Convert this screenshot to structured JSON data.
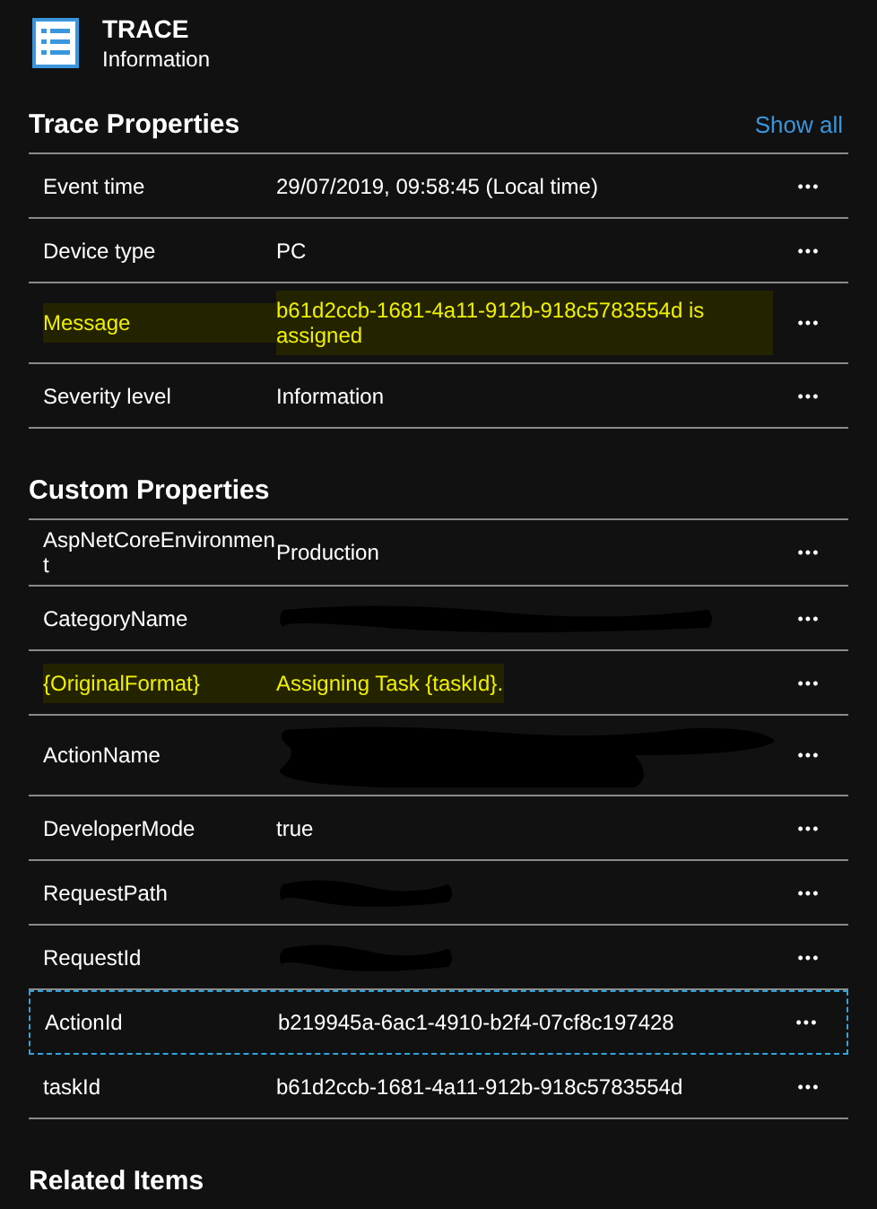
{
  "header": {
    "title": "TRACE",
    "subtitle": "Information"
  },
  "sections": [
    {
      "title": "Trace Properties",
      "link": "Show all",
      "rows": [
        {
          "kind": "text",
          "label": "Event time",
          "value": "29/07/2019, 09:58:45 (Local time)",
          "highlighted": false,
          "focused": false,
          "menu": "•••"
        },
        {
          "kind": "text",
          "label": "Device type",
          "value": "PC",
          "highlighted": false,
          "focused": false,
          "menu": "•••"
        },
        {
          "kind": "text",
          "label": "Message",
          "value": "b61d2ccb-1681-4a11-912b-918c5783554d is assigned",
          "highlighted": true,
          "focused": false,
          "menu": "•••"
        },
        {
          "kind": "text",
          "label": "Severity level",
          "value": "Information",
          "highlighted": false,
          "focused": false,
          "menu": "•••"
        }
      ]
    },
    {
      "title": "Custom Properties",
      "rows": [
        {
          "kind": "text",
          "label": "AspNetCoreEnvironment",
          "value": "Production",
          "highlighted": false,
          "focused": false,
          "menu": "•••"
        },
        {
          "kind": "redacted",
          "label": "CategoryName",
          "highlighted": false,
          "focused": false,
          "menu": "•••"
        },
        {
          "kind": "text",
          "label": "{OriginalFormat}",
          "value": "Assigning Task {taskId}.",
          "highlighted": true,
          "focused": false,
          "menu": "•••"
        },
        {
          "kind": "redacted_multiline",
          "label": "ActionName",
          "highlighted": false,
          "focused": false,
          "menu": "•••"
        },
        {
          "kind": "text",
          "label": "DeveloperMode",
          "value": "true",
          "highlighted": false,
          "focused": false,
          "menu": "•••"
        },
        {
          "kind": "redacted",
          "label": "RequestPath",
          "highlighted": false,
          "focused": false,
          "menu": "•••"
        },
        {
          "kind": "redacted",
          "label": "RequestId",
          "highlighted": false,
          "focused": false,
          "menu": "•••"
        },
        {
          "kind": "text",
          "label": "ActionId",
          "value": "b219945a-6ac1-4910-b2f4-07cf8c197428",
          "highlighted": false,
          "focused": true,
          "menu": "•••"
        },
        {
          "kind": "text",
          "label": "taskId",
          "value": "b61d2ccb-1681-4a11-912b-918c5783554d",
          "highlighted": false,
          "focused": false,
          "menu": "•••"
        }
      ]
    },
    {
      "title": "Related Items"
    }
  ]
}
